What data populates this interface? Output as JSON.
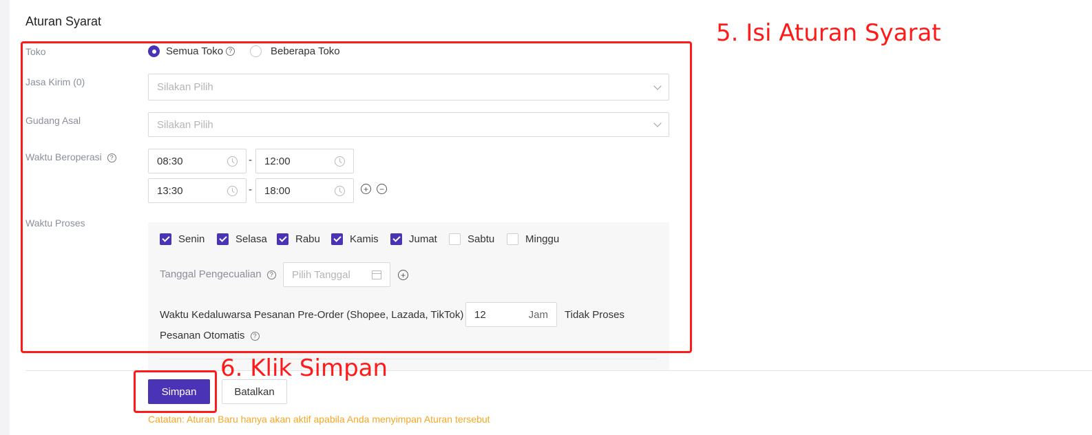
{
  "section": {
    "title": "Aturan Syarat"
  },
  "toko": {
    "label": "Toko",
    "options": [
      {
        "label": "Semua Toko",
        "selected": true
      },
      {
        "label": "Beberapa Toko",
        "selected": false
      }
    ]
  },
  "jasa_kirim": {
    "label": "Jasa Kirim (0)",
    "placeholder": "Silakan Pilih"
  },
  "gudang_asal": {
    "label": "Gudang Asal",
    "placeholder": "Silakan Pilih"
  },
  "waktu_beroperasi": {
    "label": "Waktu Beroperasi",
    "separator": "-",
    "ranges": [
      {
        "start": "08:30",
        "end": "12:00"
      },
      {
        "start": "13:30",
        "end": "18:00"
      }
    ]
  },
  "waktu_proses": {
    "label": "Waktu Proses",
    "days": [
      {
        "label": "Senin",
        "checked": true
      },
      {
        "label": "Selasa",
        "checked": true
      },
      {
        "label": "Rabu",
        "checked": true
      },
      {
        "label": "Kamis",
        "checked": true
      },
      {
        "label": "Jumat",
        "checked": true
      },
      {
        "label": "Sabtu",
        "checked": false
      },
      {
        "label": "Minggu",
        "checked": false
      }
    ],
    "exception_label": "Tanggal Pengecualian",
    "exception_placeholder": "Pilih Tanggal",
    "expiry_label": "Waktu Kedaluwarsa Pesanan Pre-Order (Shopee, Lazada, TikTok)",
    "expiry_value": "12",
    "expiry_unit": "Jam",
    "expiry_suffix_1": "Tidak Proses",
    "expiry_suffix_2": "Pesanan Otomatis"
  },
  "actions": {
    "save": "Simpan",
    "cancel": "Batalkan",
    "note": "Catatan: Aturan Baru hanya akan aktif apabila Anda menyimpan Aturan tersebut"
  },
  "annotations": {
    "step5": "5. Isi Aturan Syarat",
    "step6": "6. Klik Simpan"
  },
  "colors": {
    "primary": "#4a34b5",
    "annotation": "#ff1a1a",
    "note": "#f5a623"
  }
}
